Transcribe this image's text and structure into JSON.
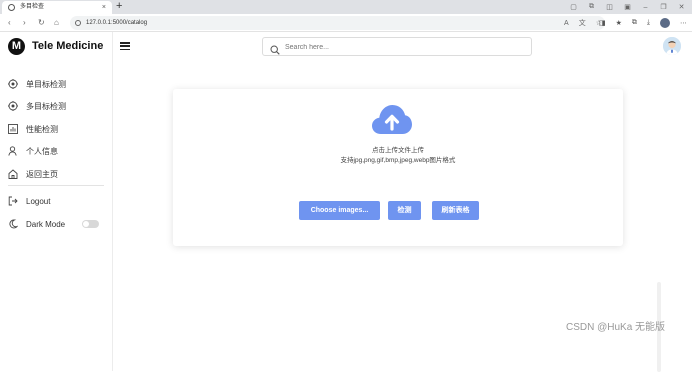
{
  "browser": {
    "tab_title": "多目检查",
    "url": "127.0.0.1:5000/catalog",
    "new_tab": "+",
    "close_tab": "×"
  },
  "app": {
    "brand_letter": "M",
    "brand_name": "Tele Medicine",
    "search_placeholder": "Search here...",
    "menu": [
      {
        "label": "单目标检测",
        "icon": "target-icon"
      },
      {
        "label": "多目标检测",
        "icon": "target-icon"
      },
      {
        "label": "性能检测",
        "icon": "bar-chart-icon"
      },
      {
        "label": "个人信息",
        "icon": "user-icon"
      },
      {
        "label": "返回主页",
        "icon": "home-icon"
      }
    ],
    "logout_label": "Logout",
    "dark_mode_label": "Dark Mode",
    "dark_mode_on": false
  },
  "upload": {
    "line1": "点击上传文件上传",
    "line2": "支持jpg,png,gif,bmp,jpeg,webp图片格式",
    "choose_label": "Choose images...",
    "detect_label": "检测",
    "refresh_label": "刷新表格",
    "accent_color": "#6f94f0"
  },
  "watermark": "CSDN @HuKa 无能版"
}
